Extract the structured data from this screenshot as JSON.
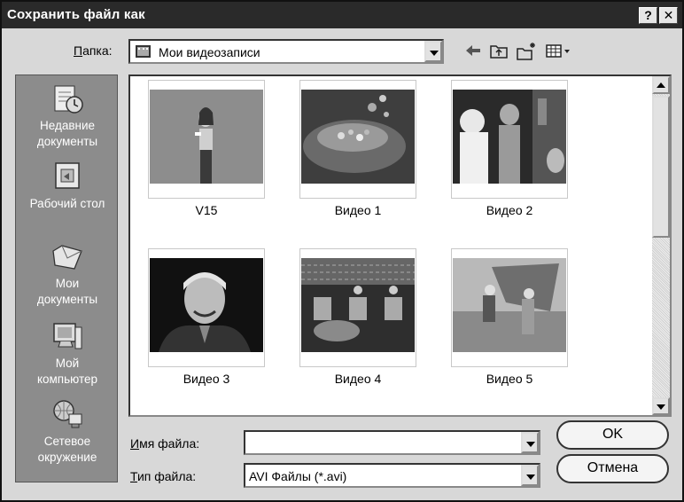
{
  "window": {
    "title": "Сохранить файл как",
    "help_label": "?",
    "close_label": "✕"
  },
  "toolbar": {
    "folder_label_accel": "П",
    "folder_label_rest": "апка:",
    "folder_value": "Мои видеозаписи",
    "icons": [
      "back-icon",
      "up-folder-icon",
      "new-folder-icon",
      "view-menu-icon"
    ]
  },
  "places": [
    {
      "id": "recent",
      "label_l1": "Недавние",
      "label_l2": "документы",
      "icon": "recent-documents-icon"
    },
    {
      "id": "desktop",
      "label_l1": "Рабочий стол",
      "label_l2": "",
      "icon": "desktop-icon"
    },
    {
      "id": "mydocs",
      "label_l1": "Мои",
      "label_l2": "документы",
      "icon": "my-documents-icon"
    },
    {
      "id": "mycomputer",
      "label_l1": "Мой",
      "label_l2": "компьютер",
      "icon": "my-computer-icon"
    },
    {
      "id": "network",
      "label_l1": "Сетевое",
      "label_l2": "окружение",
      "icon": "network-icon"
    }
  ],
  "files": [
    {
      "name": "V15"
    },
    {
      "name": "Видео 1"
    },
    {
      "name": "Видео 2"
    },
    {
      "name": "Видео 3"
    },
    {
      "name": "Видео 4"
    },
    {
      "name": "Видео 5"
    }
  ],
  "form": {
    "filename_label_accel": "И",
    "filename_label_rest": "мя файла:",
    "filename_value": "",
    "filetype_label_accel": "Т",
    "filetype_label_rest": "ип файла:",
    "filetype_value": "AVI Файлы (*.avi)"
  },
  "buttons": {
    "ok_label": "OK",
    "cancel_label": "Отмена"
  }
}
